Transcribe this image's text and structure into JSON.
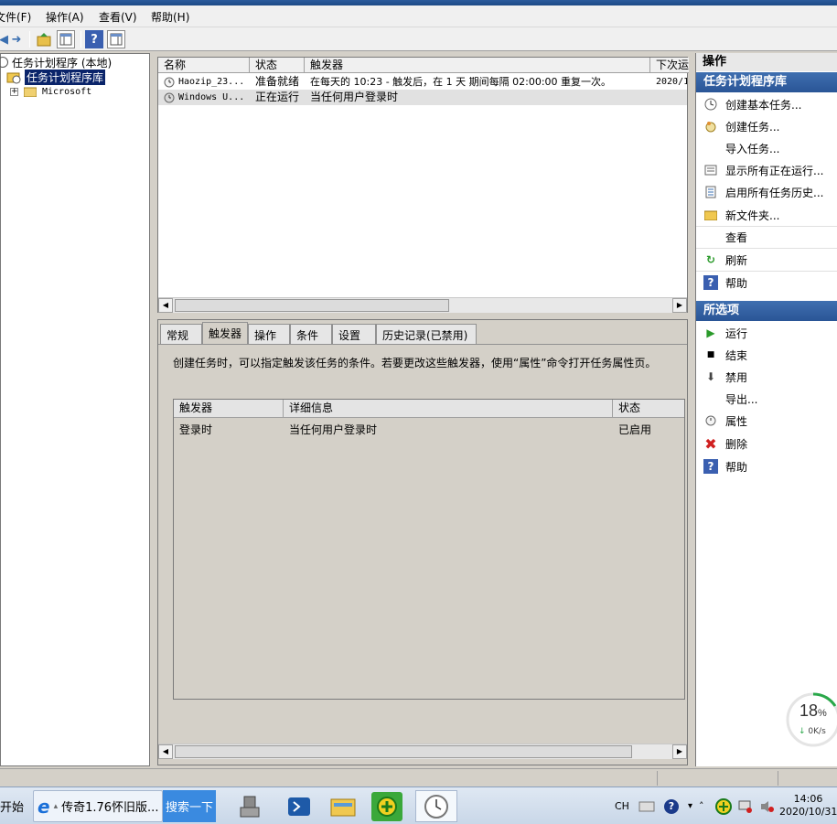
{
  "menu": [
    "文件(F)",
    "操作(A)",
    "查看(V)",
    "帮助(H)"
  ],
  "tree": {
    "root": "任务计划程序 (本地)",
    "library": "任务计划程序库",
    "child": "Microsoft"
  },
  "task_list": {
    "columns": [
      "名称",
      "状态",
      "触发器",
      "下次运"
    ],
    "rows": [
      {
        "name": "Haozip_23...",
        "status": "准备就绪",
        "trigger": "在每天的 10:23 - 触发后，在 1 天 期间每隔 02:00:00 重复一次。",
        "next": "2020/1"
      },
      {
        "name": "Windows U...",
        "status": "正在运行",
        "trigger": "当任何用户登录时",
        "next": ""
      }
    ]
  },
  "tabs": [
    "常规",
    "触发器",
    "操作",
    "条件",
    "设置",
    "历史记录(已禁用)"
  ],
  "active_tab": "触发器",
  "trigger_desc": "创建任务时，可以指定触发该任务的条件。若要更改这些触发器，使用“属性”命令打开任务属性页。",
  "trigger_table": {
    "columns": [
      "触发器",
      "详细信息",
      "状态"
    ],
    "rows": [
      {
        "trigger": "登录时",
        "detail": "当任何用户登录时",
        "status": "已启用"
      }
    ]
  },
  "actions": {
    "header": "操作",
    "section1": "任务计划程序库",
    "items1": [
      {
        "label": "创建基本任务...",
        "icon": "create-basic-task-icon"
      },
      {
        "label": "创建任务...",
        "icon": "create-task-icon"
      },
      {
        "label": "导入任务...",
        "icon": ""
      },
      {
        "label": "显示所有正在运行...",
        "icon": "show-running-icon"
      },
      {
        "label": "启用所有任务历史...",
        "icon": "enable-history-icon"
      },
      {
        "label": "新文件夹...",
        "icon": "new-folder-icon"
      },
      {
        "label": "查看",
        "icon": ""
      },
      {
        "label": "刷新",
        "icon": "refresh-icon"
      },
      {
        "label": "帮助",
        "icon": "help-icon"
      }
    ],
    "section2": "所选项",
    "items2": [
      {
        "label": "运行",
        "icon": "run-icon"
      },
      {
        "label": "结束",
        "icon": "stop-icon"
      },
      {
        "label": "禁用",
        "icon": "disable-icon"
      },
      {
        "label": "导出...",
        "icon": ""
      },
      {
        "label": "属性",
        "icon": "properties-icon"
      },
      {
        "label": "删除",
        "icon": "delete-icon"
      },
      {
        "label": "帮助",
        "icon": "help-icon"
      }
    ]
  },
  "gauge": {
    "percent": "18",
    "percent_sign": "%",
    "speed": "0K/s"
  },
  "taskbar": {
    "start": "开始",
    "ie_tab": "传奇1.76怀旧版...",
    "search_btn": "搜索一下",
    "lang": "CH",
    "time": "14:06",
    "date": "2020/10/31"
  }
}
